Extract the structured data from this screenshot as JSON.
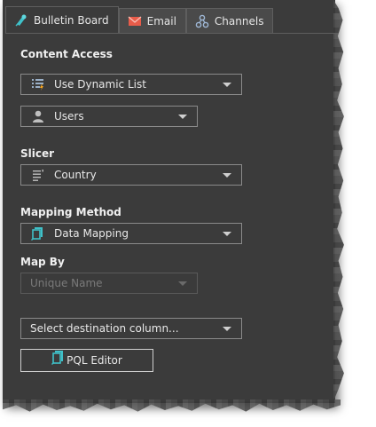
{
  "tabs": [
    {
      "label": "Bulletin Board",
      "icon": "bulletin-board-icon",
      "active": true
    },
    {
      "label": "Email",
      "icon": "email-icon",
      "active": false
    },
    {
      "label": "Channels",
      "icon": "channels-icon",
      "active": false
    }
  ],
  "content_access": {
    "label": "Content Access",
    "list_type": {
      "value": "Use Dynamic List",
      "icon": "dynamic-list-icon"
    },
    "target": {
      "value": "Users",
      "icon": "user-icon"
    }
  },
  "slicer": {
    "label": "Slicer",
    "value": "Country",
    "icon": "slicer-list-icon"
  },
  "mapping_method": {
    "label": "Mapping Method",
    "value": "Data Mapping",
    "icon": "data-mapping-icon"
  },
  "map_by": {
    "label": "Map By",
    "value": "Unique Name",
    "disabled": true
  },
  "destination": {
    "placeholder": "Select destination column..."
  },
  "pql_editor": {
    "label": "PQL Editor",
    "icon": "pql-editor-icon"
  },
  "colors": {
    "panel_bg": "#3b3b3b",
    "accent_teal": "#3fc1c9",
    "accent_orange": "#f5a623",
    "email_red": "#e85c4a"
  }
}
